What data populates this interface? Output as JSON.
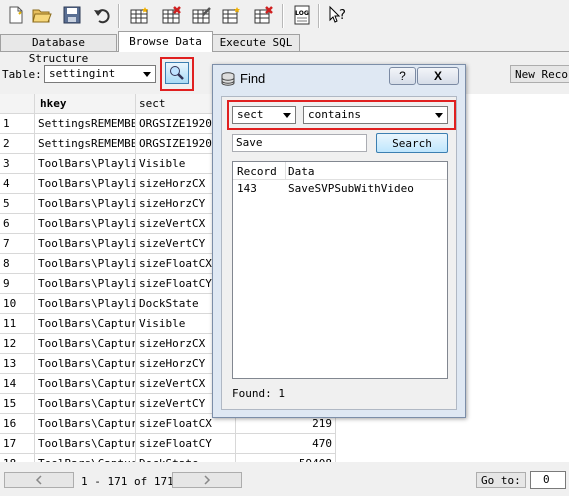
{
  "toolbar": {
    "icons": [
      "new-database-icon",
      "open-database-icon",
      "save-icon",
      "undo-icon",
      "create-table-icon",
      "delete-table-icon",
      "modify-table-icon",
      "create-index-icon",
      "delete-index-icon",
      "log-icon",
      "whats-this-icon"
    ],
    "log_text": "LOG"
  },
  "tabs": [
    "Database Structure",
    "Browse Data",
    "Execute SQL"
  ],
  "browse": {
    "table_label": "Table:",
    "table_value": "settingint",
    "new_record_label": "New Recor"
  },
  "grid": {
    "columns": [
      "",
      "hkey",
      "sect",
      ""
    ],
    "rows": [
      {
        "num": "1",
        "hkey": "SettingsREMEMBER",
        "sect": "ORGSIZE1920x1",
        "value": ""
      },
      {
        "num": "2",
        "hkey": "SettingsREMEMBER",
        "sect": "ORGSIZE1920x1",
        "value": ""
      },
      {
        "num": "3",
        "hkey": "ToolBars\\Playlis",
        "sect": "Visible",
        "value": ""
      },
      {
        "num": "4",
        "hkey": "ToolBars\\Playlis",
        "sect": "sizeHorzCX",
        "value": ""
      },
      {
        "num": "5",
        "hkey": "ToolBars\\Playlis",
        "sect": "sizeHorzCY",
        "value": ""
      },
      {
        "num": "6",
        "hkey": "ToolBars\\Playlis",
        "sect": "sizeVertCX",
        "value": ""
      },
      {
        "num": "7",
        "hkey": "ToolBars\\Playlis",
        "sect": "sizeVertCY",
        "value": ""
      },
      {
        "num": "8",
        "hkey": "ToolBars\\Playlis",
        "sect": "sizeFloatCX",
        "value": ""
      },
      {
        "num": "9",
        "hkey": "ToolBars\\Playlis",
        "sect": "sizeFloatCY",
        "value": ""
      },
      {
        "num": "10",
        "hkey": "ToolBars\\Playlis",
        "sect": "DockState",
        "value": ""
      },
      {
        "num": "11",
        "hkey": "ToolBars\\Capture",
        "sect": "Visible",
        "value": ""
      },
      {
        "num": "12",
        "hkey": "ToolBars\\Capture",
        "sect": "sizeHorzCX",
        "value": ""
      },
      {
        "num": "13",
        "hkey": "ToolBars\\Capture",
        "sect": "sizeHorzCY",
        "value": ""
      },
      {
        "num": "14",
        "hkey": "ToolBars\\Capture",
        "sect": "sizeVertCX",
        "value": ""
      },
      {
        "num": "15",
        "hkey": "ToolBars\\Capture",
        "sect": "sizeVertCY",
        "value": ""
      },
      {
        "num": "16",
        "hkey": "ToolBars\\Capture",
        "sect": "sizeFloatCX",
        "value": "219"
      },
      {
        "num": "17",
        "hkey": "ToolBars\\Capture",
        "sect": "sizeFloatCY",
        "value": "470"
      },
      {
        "num": "18",
        "hkey": "ToolBars\\Capture",
        "sect": "DockState",
        "value": "59408"
      }
    ]
  },
  "pager": {
    "prev_icon": "chevron-left-icon",
    "status": "1 - 171 of 171",
    "next_icon": "chevron-right-icon",
    "goto_label": "Go to:",
    "goto_value": "0"
  },
  "find": {
    "title": "Find",
    "help_label": "?",
    "close_label": "X",
    "field_value": "sect",
    "operator_value": "contains",
    "search_text": "Save",
    "search_button": "Search",
    "results_headers": [
      "Record",
      "Data"
    ],
    "results": [
      {
        "record": "143",
        "data": "SaveSVPSubWithVideo"
      }
    ],
    "found_label": "Found: 1"
  },
  "accent": {
    "highlight": "#e02020",
    "dialog_bg": "#dfe8f3"
  }
}
